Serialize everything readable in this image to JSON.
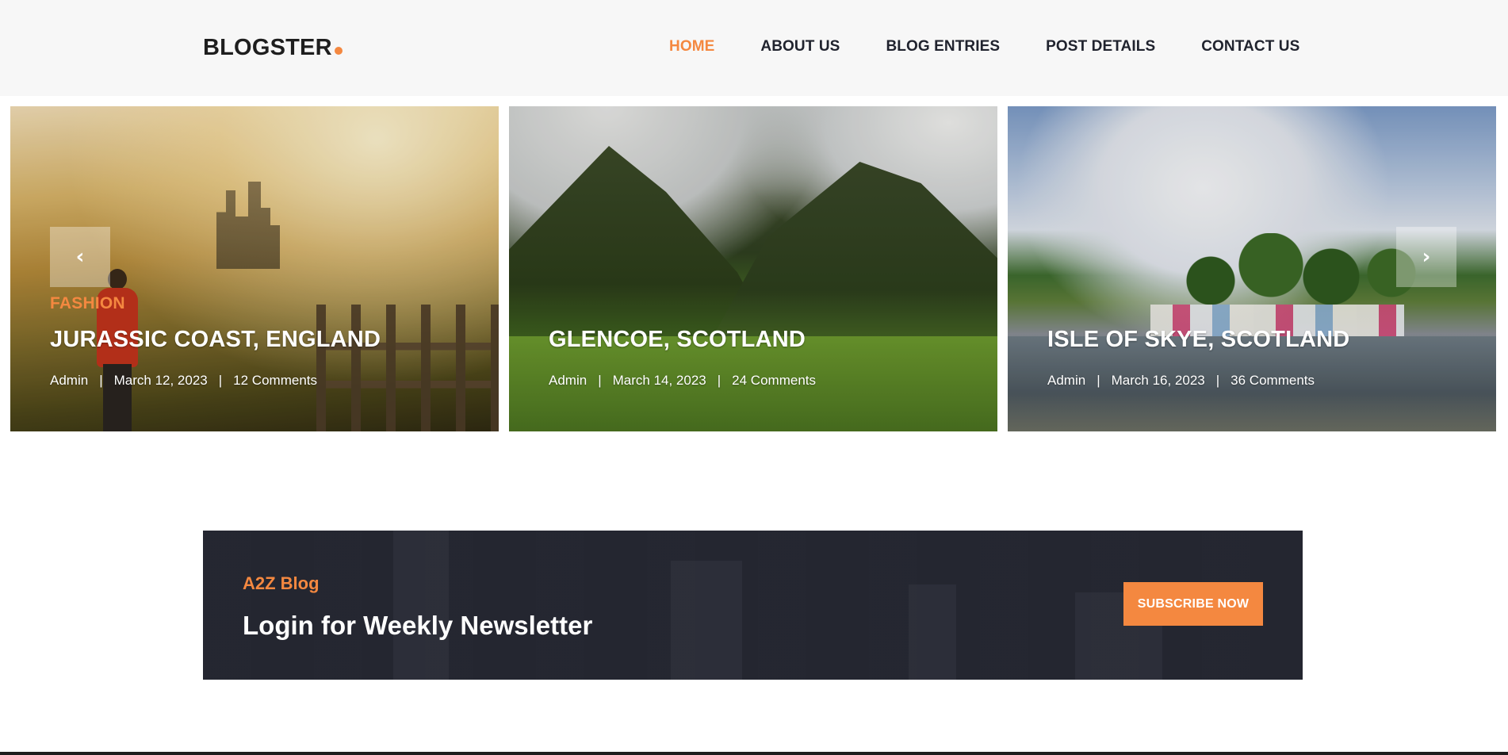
{
  "brand": {
    "name": "BLOGSTER",
    "accent_color": "#f48840"
  },
  "nav": {
    "items": [
      {
        "label": "HOME",
        "active": true
      },
      {
        "label": "ABOUT US",
        "active": false
      },
      {
        "label": "BLOG ENTRIES",
        "active": false
      },
      {
        "label": "POST DETAILS",
        "active": false
      },
      {
        "label": "CONTACT US",
        "active": false
      }
    ]
  },
  "carousel": {
    "prev_icon": "chevron-left-icon",
    "next_icon": "chevron-right-icon",
    "prev_glyph": "‹",
    "next_glyph": "›",
    "slides": [
      {
        "category": "FASHION",
        "title": "JURASSIC COAST, ENGLAND",
        "author": "Admin",
        "date": "March 12, 2023",
        "comments": "12 Comments"
      },
      {
        "category": "",
        "title": "GLENCOE, SCOTLAND",
        "author": "Admin",
        "date": "March 14, 2023",
        "comments": "24 Comments"
      },
      {
        "category": "",
        "title": "ISLE OF SKYE, SCOTLAND",
        "author": "Admin",
        "date": "March 16, 2023",
        "comments": "36 Comments"
      }
    ],
    "separator": "|"
  },
  "newsletter": {
    "kicker": "A2Z Blog",
    "title": "Login for Weekly Newsletter",
    "button_label": "SUBSCRIBE NOW"
  }
}
